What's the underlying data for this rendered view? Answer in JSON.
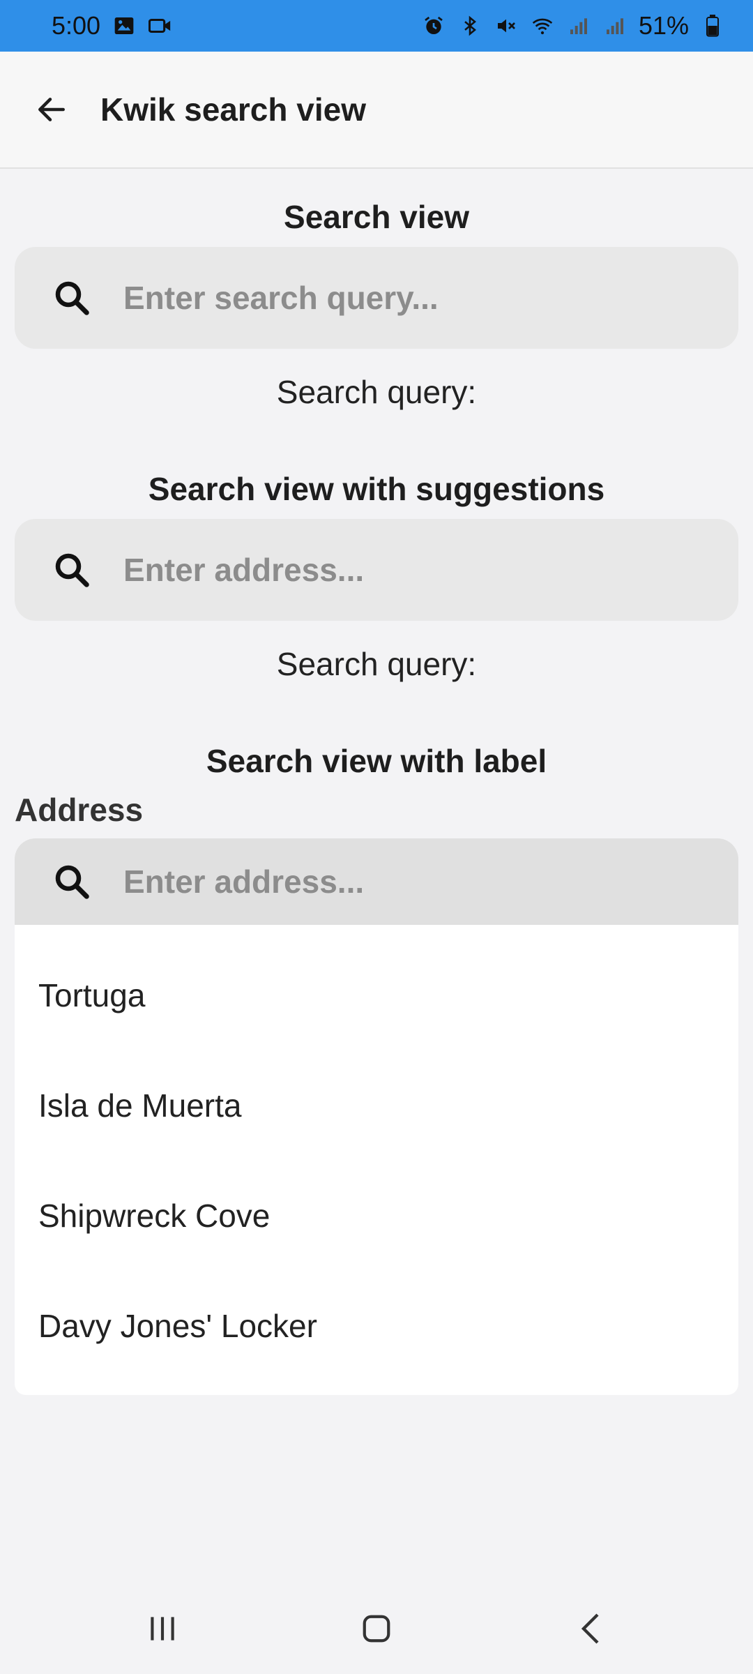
{
  "status_bar": {
    "time": "5:00",
    "battery": "51%",
    "icons_left": [
      "gallery-icon",
      "video-icon"
    ],
    "icons_right": [
      "alarm-icon",
      "bluetooth-icon",
      "mute-icon",
      "wifi-icon",
      "signal-icon",
      "signal-icon",
      "battery-icon"
    ]
  },
  "app_bar": {
    "title": "Kwik search view"
  },
  "sections": {
    "search_view": {
      "title": "Search view",
      "placeholder": "Enter search query...",
      "query_label": "Search query:"
    },
    "search_with_suggestions": {
      "title": "Search view with suggestions",
      "placeholder": "Enter address...",
      "query_label": "Search query:"
    },
    "search_with_label": {
      "title": "Search view with label",
      "field_label": "Address",
      "placeholder": "Enter address...",
      "suggestions": [
        "Tortuga",
        "Isla de Muerta",
        "Shipwreck Cove",
        "Davy Jones' Locker"
      ]
    }
  },
  "colors": {
    "status_bar": "#2f8fe8",
    "background": "#f3f3f5",
    "search_box": "#e8e8e8"
  }
}
